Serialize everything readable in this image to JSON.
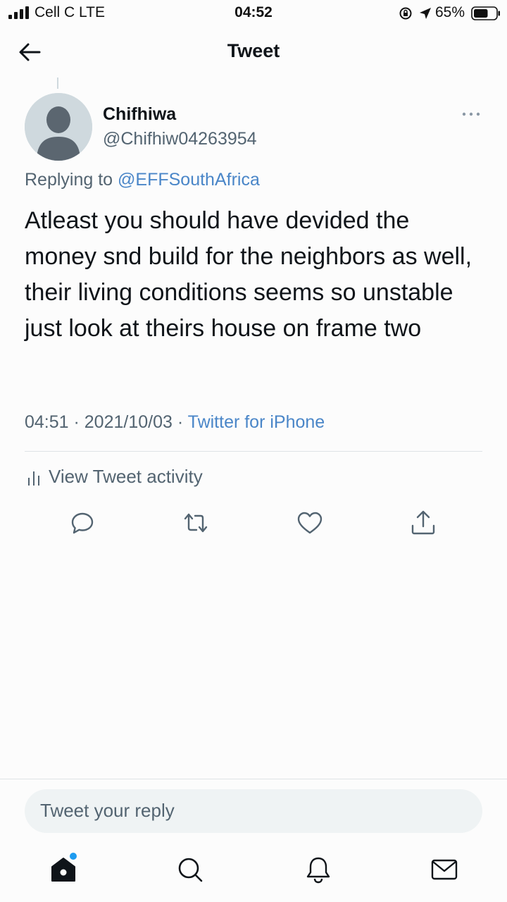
{
  "status_bar": {
    "carrier": "Cell C  LTE",
    "time": "04:52",
    "battery": "65%",
    "battery_level": 0.65
  },
  "header": {
    "title": "Tweet"
  },
  "tweet": {
    "display_name": "Chifhiwa",
    "handle": "@Chifhiw04263954",
    "replying_prefix": "Replying to ",
    "replying_to": "@EFFSouthAfrica",
    "text": "Atleast you should have devided the money snd build for the neighbors as well, their living conditions seems so unstable just look at theirs house on frame two",
    "time": "04:51",
    "separator": " · ",
    "date": "2021/10/03",
    "source": "Twitter for iPhone",
    "activity_label": "View Tweet activity"
  },
  "actions": [
    "reply-icon",
    "retweet-icon",
    "like-icon",
    "share-icon"
  ],
  "reply_bar": {
    "placeholder": "Tweet your reply"
  },
  "tab_bar": [
    "home-icon",
    "search-icon",
    "notifications-icon",
    "messages-icon"
  ],
  "colors": {
    "accent": "#1d9bf0",
    "link": "#4a86c8",
    "secondary_text": "#536471",
    "primary_text": "#0f1419"
  }
}
